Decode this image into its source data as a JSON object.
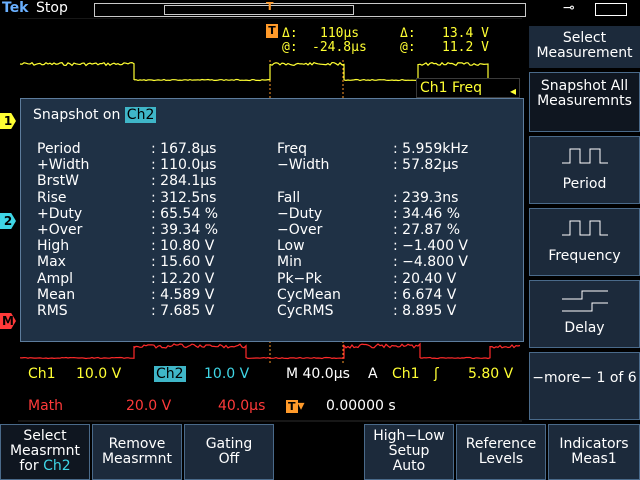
{
  "topbar": {
    "brand": "Tek",
    "status": "Stop"
  },
  "cursor_readout": {
    "delta_time_label": "Δ:",
    "delta_time": "110µs",
    "at_time_label": "@:",
    "at_time": "-24.8µs",
    "delta_volt_label": "Δ:",
    "delta_volt": "13.4 V",
    "at_volt_label": "@:",
    "at_volt": "11.2 V",
    "trigger_badge": "T"
  },
  "ch1_freq_label": "Ch1 Freq",
  "snapshot": {
    "title_prefix": "Snapshot on",
    "channel": "Ch2",
    "left": [
      {
        "label": "Period",
        "value": ": 167.8µs"
      },
      {
        "label": "+Width",
        "value": ": 110.0µs"
      },
      {
        "label": "BrstW",
        "value": ": 284.1µs"
      },
      {
        "label": "Rise",
        "value": ": 312.5ns"
      },
      {
        "label": "+Duty",
        "value": ": 65.54 %"
      },
      {
        "label": "+Over",
        "value": ": 39.34 %"
      },
      {
        "label": "High",
        "value": ": 10.80 V"
      },
      {
        "label": "Max",
        "value": ": 15.60 V"
      },
      {
        "label": "Ampl",
        "value": ": 12.20 V"
      },
      {
        "label": "Mean",
        "value": ": 4.589 V"
      },
      {
        "label": "RMS",
        "value": ": 7.685 V"
      }
    ],
    "right": [
      {
        "label": "Freq",
        "value": ": 5.959kHz",
        "row": 0
      },
      {
        "label": "−Width",
        "value": ": 57.82µs",
        "row": 1
      },
      {
        "label": "Fall",
        "value": ": 239.3ns",
        "row": 3
      },
      {
        "label": "−Duty",
        "value": ": 34.46 %",
        "row": 4
      },
      {
        "label": "−Over",
        "value": ": 27.87 %",
        "row": 5
      },
      {
        "label": "Low",
        "value": ": −1.400 V",
        "row": 6
      },
      {
        "label": "Min",
        "value": ": −4.800 V",
        "row": 7
      },
      {
        "label": "Pk−Pk",
        "value": ": 20.40 V",
        "row": 8
      },
      {
        "label": "CycMean",
        "value": ": 6.674 V",
        "row": 9
      },
      {
        "label": "CycRMS",
        "value": ": 8.895 V",
        "row": 10
      }
    ]
  },
  "status_line": {
    "ch1_label": "Ch1",
    "ch1_scale": "10.0 V",
    "ch2_label": "Ch2",
    "ch2_scale": "10.0 V",
    "timebase": "M 40.0µs",
    "trig_source_prefix": "A",
    "trig_source": "Ch1",
    "trig_level": "5.80 V",
    "math_label": "Math",
    "math_scale": "20.0 V",
    "math_time": "40.0µs",
    "trig_position": "0.00000 s"
  },
  "channel_markers": {
    "ch1": "1",
    "ch2": "2",
    "math": "M"
  },
  "right_menu": [
    {
      "label": "Select Measurement"
    },
    {
      "label": "Snapshot All Measuremnts"
    },
    {
      "label": "Period"
    },
    {
      "label": "Frequency"
    },
    {
      "label": "Delay"
    },
    {
      "label": "−more− 1 of 6"
    }
  ],
  "bottom_menu": [
    {
      "label_a": "Select",
      "label_b": "Measrmnt",
      "label_c": "for",
      "label_d": "Ch2"
    },
    {
      "label_a": "Remove",
      "label_b": "Measrmnt"
    },
    {
      "label_a": "Gating",
      "label_b": "Off"
    },
    {
      "label_a": "High−Low",
      "label_b": "Setup",
      "label_c": "Auto"
    },
    {
      "label_a": "Reference",
      "label_b": "Levels"
    },
    {
      "label_a": "Indicators",
      "label_b": "Meas1"
    }
  ],
  "colors": {
    "ch1": "#ffff33",
    "ch2": "#3fd6e6",
    "ch2_wave": "#ff2a2a",
    "math": "#ff3a3a",
    "trigger": "#ff9a2a",
    "panel": "#1f3145"
  }
}
